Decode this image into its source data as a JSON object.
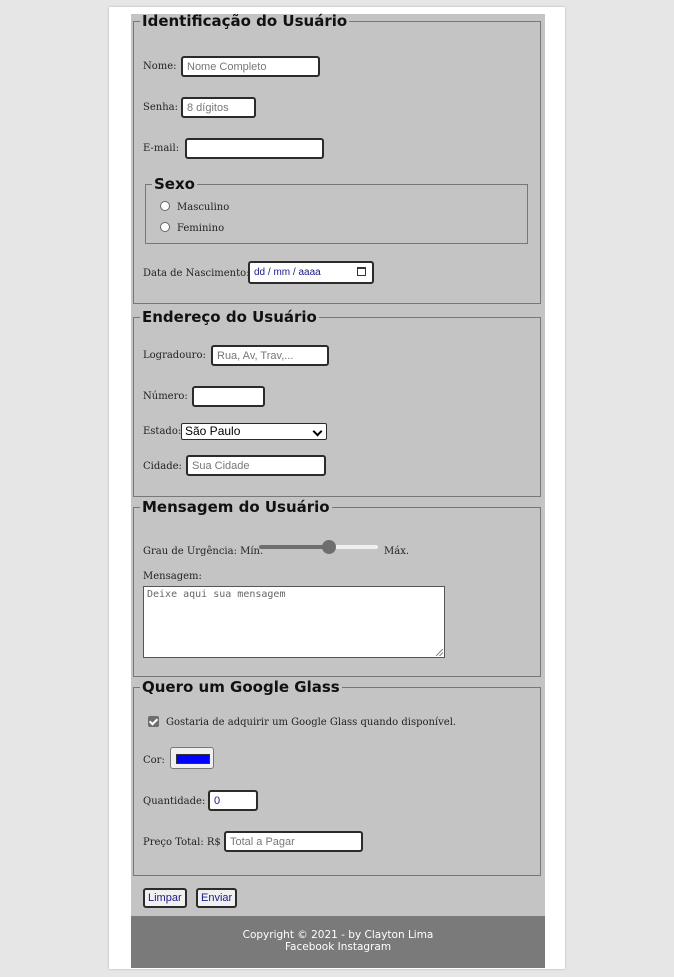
{
  "identificacao": {
    "legend": "Identificação do Usuário",
    "nome_label": "Nome:",
    "nome_placeholder": "Nome Completo",
    "senha_label": "Senha:",
    "senha_placeholder": "8 dígitos",
    "email_label": "E-mail:",
    "email_value": "",
    "sexo": {
      "legend": "Sexo",
      "options": [
        "Masculino",
        "Feminino"
      ]
    },
    "nascimento_label": "Data de Nascimento:",
    "nascimento_placeholder": "dd / mm / aaaa"
  },
  "endereco": {
    "legend": "Endereço do Usuário",
    "logradouro_label": "Logradouro:",
    "logradouro_placeholder": "Rua, Av, Trav,...",
    "numero_label": "Número:",
    "numero_value": "",
    "estado_label": "Estado:",
    "estado_selected": "São Paulo",
    "cidade_label": "Cidade:",
    "cidade_placeholder": "Sua Cidade"
  },
  "mensagem": {
    "legend": "Mensagem do Usuário",
    "urgencia_label": "Grau de Urgência: Mín.",
    "urgencia_max": "Máx.",
    "urgencia_value": 0.6,
    "mensagem_label": "Mensagem:",
    "mensagem_placeholder": "Deixe aqui sua mensagem"
  },
  "glass": {
    "legend": "Quero um Google Glass",
    "checkbox_label": "Gostaria de adquirir um Google Glass quando disponível.",
    "checkbox_checked": true,
    "cor_label": "Cor:",
    "cor_value": "#0000ff",
    "quantidade_label": "Quantidade:",
    "quantidade_value": "0",
    "preco_label": "Preço Total: R$",
    "preco_placeholder": "Total a Pagar"
  },
  "buttons": {
    "limpar": "Limpar",
    "enviar": "Enviar"
  },
  "footer": {
    "copyright": "Copyright © 2021 - by Clayton Lima",
    "links": "Facebook Instagram"
  },
  "colors": {
    "form_bg": "#c4c4c4",
    "footer_bg": "#7a7a7a",
    "slider_fill": "#6e6e6e"
  }
}
